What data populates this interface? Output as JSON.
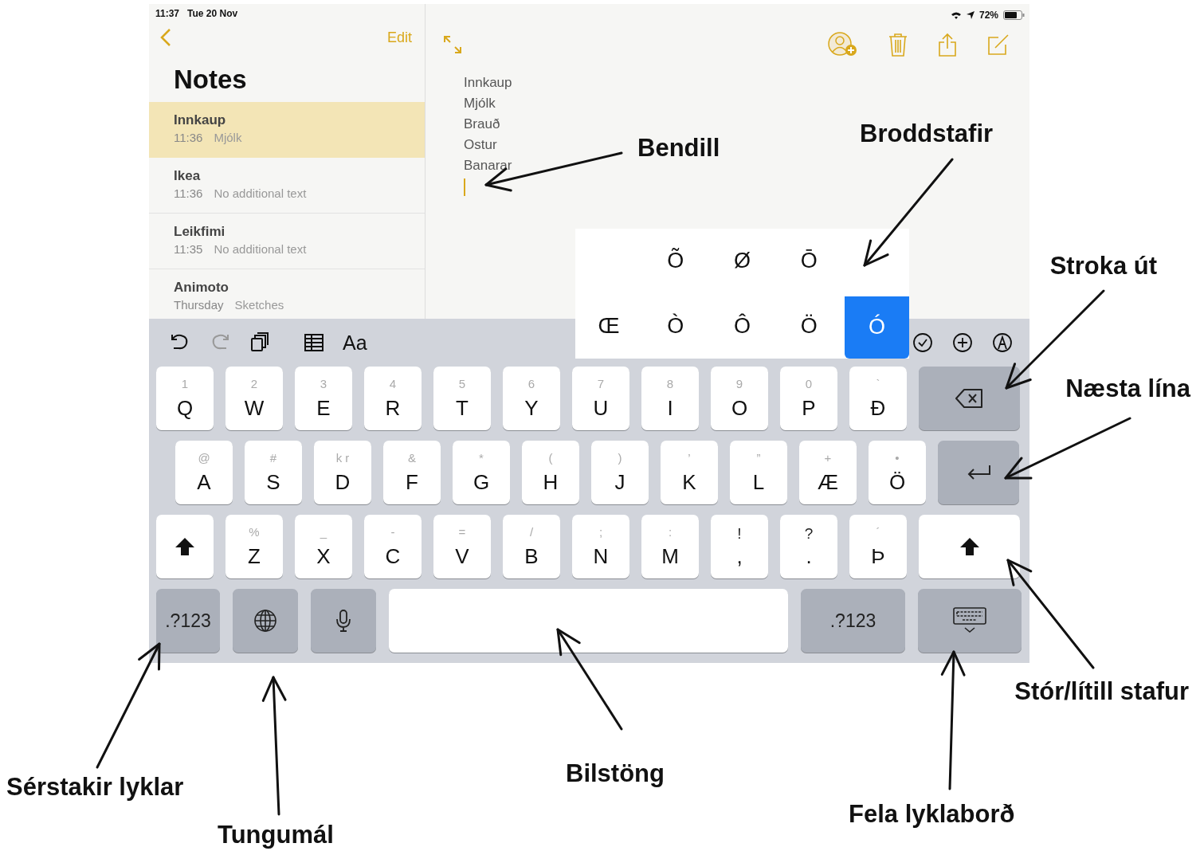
{
  "status_bar": {
    "time": "11:37",
    "date": "Tue 20 Nov",
    "battery": "72%"
  },
  "sidebar": {
    "edit": "Edit",
    "title": "Notes",
    "notes": [
      {
        "title": "Innkaup",
        "time": "11:36",
        "preview": "Mjólk",
        "selected": true
      },
      {
        "title": "Ikea",
        "time": "11:36",
        "preview": "No additional text",
        "selected": false
      },
      {
        "title": "Leikfimi",
        "time": "11:35",
        "preview": "No additional text",
        "selected": false
      },
      {
        "title": "Animoto",
        "time": "Thursday",
        "preview": "Sketches",
        "selected": false
      }
    ]
  },
  "note": {
    "lines": [
      "Innkaup",
      "Mjólk",
      "Brauð",
      "Ostur",
      "Banarar"
    ]
  },
  "keyboard": {
    "toolbar": [
      {
        "kind": "undo",
        "disabled": false
      },
      {
        "kind": "redo",
        "disabled": true
      },
      {
        "kind": "copy",
        "disabled": false
      },
      {
        "kind": "table",
        "disabled": false
      },
      {
        "kind": "format",
        "label": "Aa",
        "disabled": false
      },
      {
        "kind": "check",
        "disabled": false
      },
      {
        "kind": "plus",
        "disabled": false
      },
      {
        "kind": "markup",
        "disabled": false
      }
    ],
    "accent_popup": [
      [
        {
          "char": "Õ",
          "selected": false
        },
        {
          "char": "Ø",
          "selected": false
        },
        {
          "char": "Ō",
          "selected": false
        }
      ],
      [
        {
          "char": "Œ",
          "selected": false
        },
        {
          "char": "Ò",
          "selected": false
        },
        {
          "char": "Ô",
          "selected": false
        },
        {
          "char": "Ö",
          "selected": false
        },
        {
          "char": "Ó",
          "selected": true
        }
      ]
    ],
    "rows": [
      [
        {
          "kind": "letter",
          "label": "Q",
          "hint": "1"
        },
        {
          "kind": "letter",
          "label": "W",
          "hint": "2"
        },
        {
          "kind": "letter",
          "label": "E",
          "hint": "3"
        },
        {
          "kind": "letter",
          "label": "R",
          "hint": "4"
        },
        {
          "kind": "letter",
          "label": "T",
          "hint": "5"
        },
        {
          "kind": "letter",
          "label": "Y",
          "hint": "6"
        },
        {
          "kind": "letter",
          "label": "U",
          "hint": "7"
        },
        {
          "kind": "letter",
          "label": "I",
          "hint": "8"
        },
        {
          "kind": "letter",
          "label": "O",
          "hint": "9"
        },
        {
          "kind": "letter",
          "label": "P",
          "hint": "0"
        },
        {
          "kind": "letter",
          "label": "Ð",
          "hint": "`"
        },
        {
          "kind": "delete"
        }
      ],
      [
        {
          "kind": "letter",
          "label": "A",
          "hint": "@"
        },
        {
          "kind": "letter",
          "label": "S",
          "hint": "#"
        },
        {
          "kind": "letter",
          "label": "D",
          "hint": "k r"
        },
        {
          "kind": "letter",
          "label": "F",
          "hint": "&"
        },
        {
          "kind": "letter",
          "label": "G",
          "hint": "*"
        },
        {
          "kind": "letter",
          "label": "H",
          "hint": "("
        },
        {
          "kind": "letter",
          "label": "J",
          "hint": ")"
        },
        {
          "kind": "letter",
          "label": "K",
          "hint": "’"
        },
        {
          "kind": "letter",
          "label": "L",
          "hint": "”"
        },
        {
          "kind": "letter",
          "label": "Æ",
          "hint": "+"
        },
        {
          "kind": "letter",
          "label": "Ö",
          "hint": "•"
        },
        {
          "kind": "return"
        }
      ],
      [
        {
          "kind": "shift"
        },
        {
          "kind": "letter",
          "label": "Z",
          "hint": "%"
        },
        {
          "kind": "letter",
          "label": "X",
          "hint": "_"
        },
        {
          "kind": "letter",
          "label": "C",
          "hint": "-"
        },
        {
          "kind": "letter",
          "label": "V",
          "hint": "="
        },
        {
          "kind": "letter",
          "label": "B",
          "hint": "/"
        },
        {
          "kind": "letter",
          "label": "N",
          "hint": ";"
        },
        {
          "kind": "letter",
          "label": "M",
          "hint": ":"
        },
        {
          "kind": "punct",
          "label": ",",
          "hint": "!"
        },
        {
          "kind": "punct",
          "label": ".",
          "hint": "?"
        },
        {
          "kind": "letter",
          "label": "Þ",
          "hint": "´"
        },
        {
          "kind": "shift_wide"
        }
      ],
      [
        {
          "kind": "symbols",
          "label": ".?123"
        },
        {
          "kind": "globe"
        },
        {
          "kind": "mic"
        },
        {
          "kind": "space"
        },
        {
          "kind": "symbols_wide",
          "label": ".?123"
        },
        {
          "kind": "hide"
        }
      ]
    ]
  },
  "annotations": [
    "Bendill",
    "Broddstafir",
    "Stroka út",
    "Næsta lína",
    "Stór/lítill stafur",
    "Fela lyklaborð",
    "Bilstöng",
    "Tungumál",
    "Sérstakir lyklar"
  ]
}
